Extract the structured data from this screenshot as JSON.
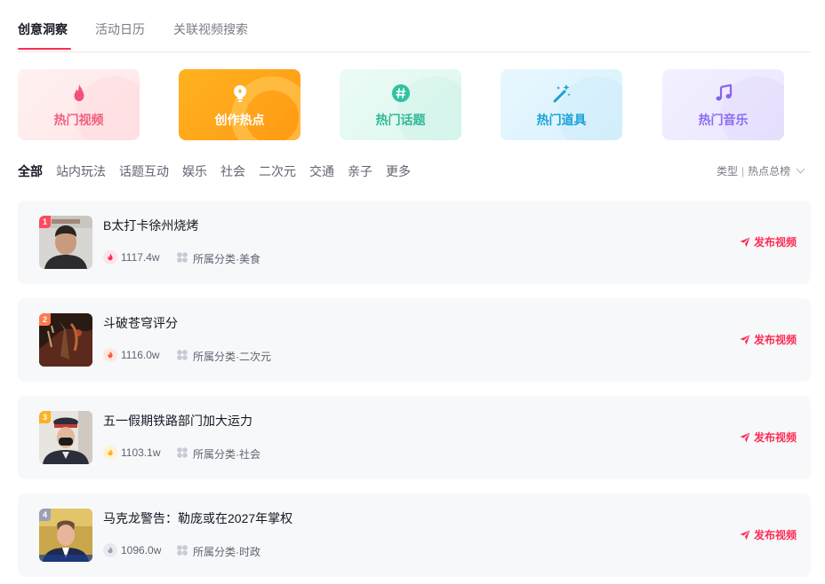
{
  "top_tabs": [
    {
      "label": "创意洞察",
      "active": true
    },
    {
      "label": "活动日历",
      "active": false
    },
    {
      "label": "关联视频搜索",
      "active": false
    }
  ],
  "cards": [
    {
      "label": "热门视频",
      "icon": "flame-icon",
      "color": "#f0617f"
    },
    {
      "label": "创作热点",
      "icon": "lightbulb-icon",
      "color": "#ffffff"
    },
    {
      "label": "热门话题",
      "icon": "hashtag-icon",
      "color": "#2fb997"
    },
    {
      "label": "热门道具",
      "icon": "magic-wand-icon",
      "color": "#17a3d8"
    },
    {
      "label": "热门音乐",
      "icon": "music-note-icon",
      "color": "#8b6cf0"
    }
  ],
  "filters": [
    "全部",
    "站内玩法",
    "话题互动",
    "娱乐",
    "社会",
    "二次元",
    "交通",
    "亲子",
    "更多"
  ],
  "sort": {
    "type_label": "类型",
    "value": "热点总榜"
  },
  "items": [
    {
      "rank": "1",
      "title": "B太打卡徐州烧烤",
      "heat": "1117.4w",
      "category": "所属分类·美食",
      "action": "发布视频",
      "rank_color": "#fe4a5d",
      "heat_color": "#fe2c55"
    },
    {
      "rank": "2",
      "title": "斗破苍穹评分",
      "heat": "1116.0w",
      "category": "所属分类·二次元",
      "action": "发布视频",
      "rank_color": "#ff7a4d",
      "heat_color": "#fe5a3a"
    },
    {
      "rank": "3",
      "title": "五一假期铁路部门加大运力",
      "heat": "1103.1w",
      "category": "所属分类·社会",
      "action": "发布视频",
      "rank_color": "#ffb21f",
      "heat_color": "#ffb21f"
    },
    {
      "rank": "4",
      "title": "马克龙警告：勒庞或在2027年掌权",
      "heat": "1096.0w",
      "category": "所属分类·时政",
      "action": "发布视频",
      "rank_color": "#9aa0b4",
      "heat_color": "#9aa0b4"
    }
  ],
  "colors": {
    "accent": "#fe2c55",
    "item_bg": "#f7f8fa"
  }
}
